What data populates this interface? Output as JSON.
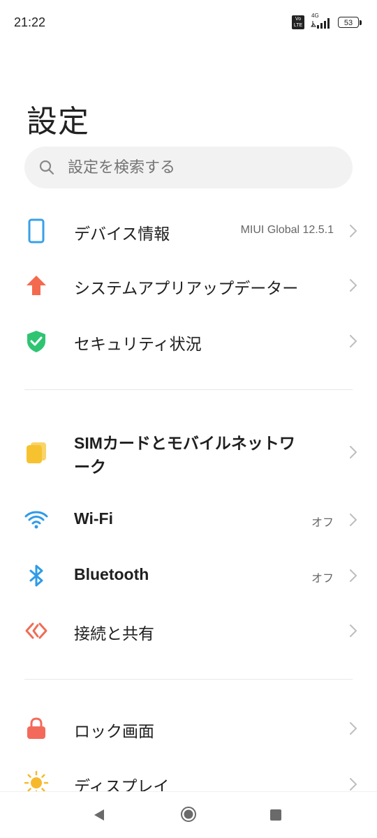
{
  "status_bar": {
    "time": "21:22",
    "volte": "Vo LTE",
    "network_type": "4G",
    "battery": "53"
  },
  "header": {
    "title": "設定"
  },
  "search": {
    "placeholder": "設定を検索する"
  },
  "groups": [
    {
      "items": [
        {
          "label": "デバイス情報",
          "value": "MIUI Global 12.5.1",
          "icon": "phone-icon",
          "color": "#3aa0e8"
        },
        {
          "label": "システムアプリアップデーター",
          "value": "",
          "icon": "arrow-up-icon",
          "color": "#f46a4e"
        },
        {
          "label": "セキュリティ状況",
          "value": "",
          "icon": "shield-check-icon",
          "color": "#2fc472"
        }
      ]
    },
    {
      "items": [
        {
          "label": "SIMカードとモバイルネットワ",
          "label_line2": "ーク",
          "value": "",
          "icon": "sim-card-icon",
          "color": "#f7c230"
        },
        {
          "label": "Wi-Fi",
          "value": "オフ",
          "icon": "wifi-icon",
          "color": "#2f9be8"
        },
        {
          "label": "Bluetooth",
          "value": "オフ",
          "icon": "bluetooth-icon",
          "color": "#2f9be8"
        },
        {
          "label": "接続と共有",
          "value": "",
          "icon": "share-icon",
          "color": "#ef6d55"
        }
      ]
    },
    {
      "items": [
        {
          "label": "ロック画面",
          "value": "",
          "icon": "lock-icon",
          "color": "#f46a5a"
        },
        {
          "label": "ディスプレイ",
          "value": "",
          "icon": "sun-icon",
          "color": "#f7b92c"
        }
      ]
    }
  ],
  "nav_bar": {
    "buttons": [
      "back",
      "home",
      "recents"
    ]
  }
}
